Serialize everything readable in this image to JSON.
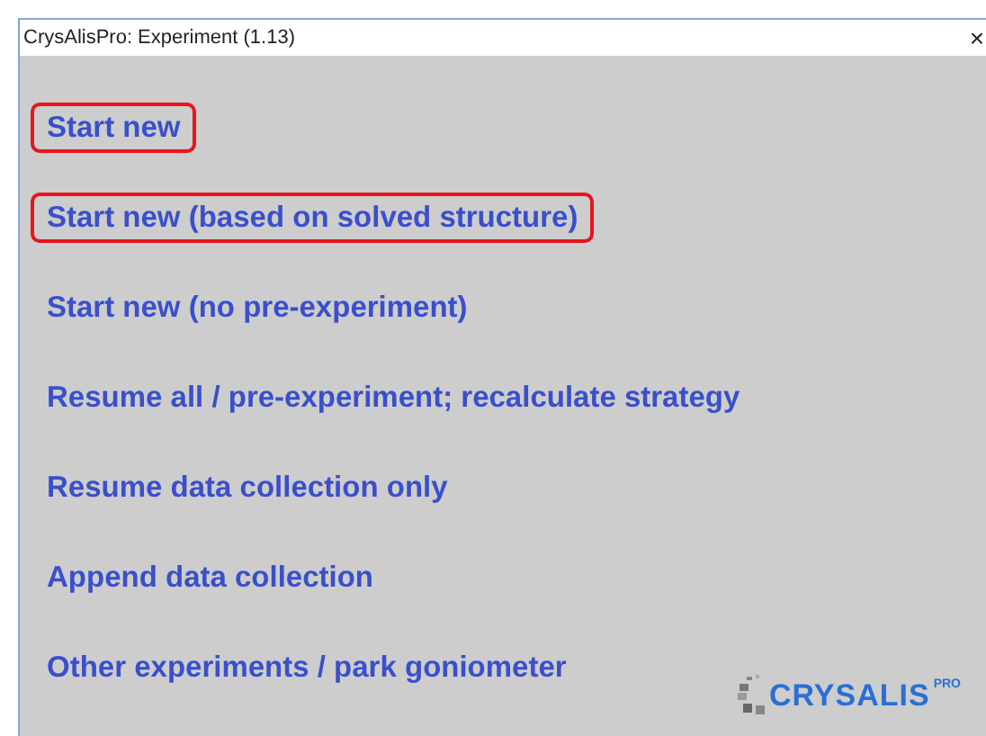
{
  "window": {
    "title": "CrysAlisPro: Experiment (1.13)",
    "close": "×"
  },
  "options": [
    {
      "label": "Start new",
      "highlighted": true
    },
    {
      "label": "Start new (based on solved structure)",
      "highlighted": true
    },
    {
      "label": "Start new (no pre-experiment)",
      "highlighted": false
    },
    {
      "label": "Resume all / pre-experiment; recalculate strategy",
      "highlighted": false
    },
    {
      "label": "Resume data collection only",
      "highlighted": false
    },
    {
      "label": "Append data collection",
      "highlighted": false
    },
    {
      "label": "Other experiments / park goniometer",
      "highlighted": false
    }
  ],
  "logo": {
    "text": "CRYSALIS",
    "superscript": "PRO"
  }
}
